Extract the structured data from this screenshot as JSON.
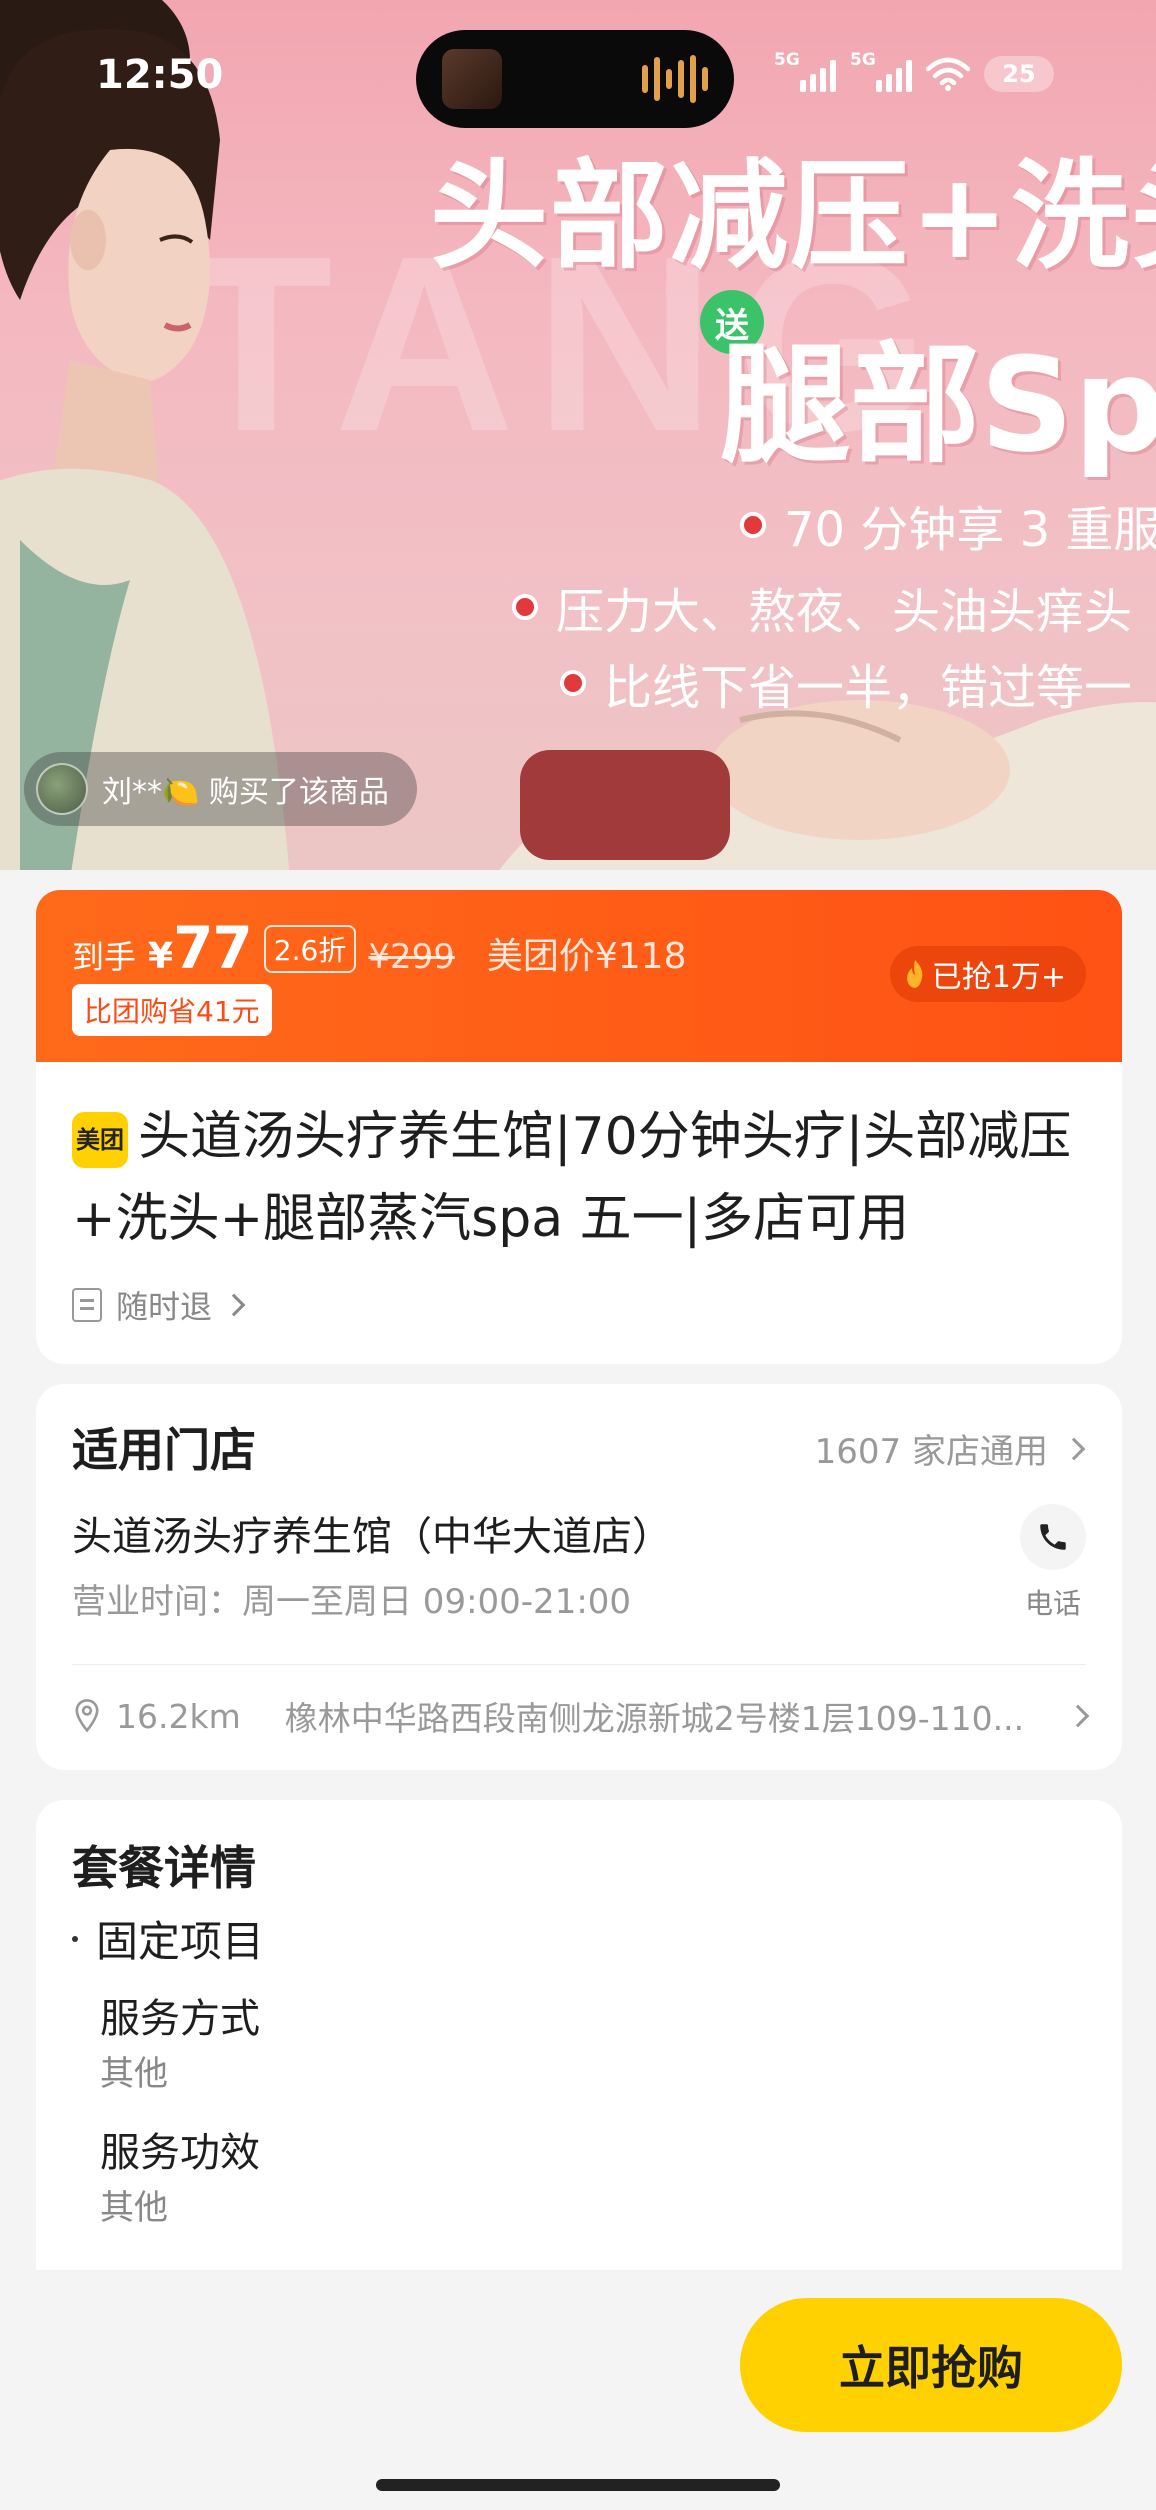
{
  "status_bar": {
    "time": "12:50",
    "signal1_label": "5G",
    "signal2_label": "5G",
    "battery": "25"
  },
  "hero": {
    "headline": "头部减压+洗头",
    "gift_badge": "送",
    "sub_headline": "腿部Sp",
    "bullets": [
      "70 分钟享 3 重服",
      "压力大、熬夜、头油头痒头",
      "比线下省一半，错过等一"
    ],
    "buyer_notice": "刘**🍋 购买了该商品"
  },
  "price": {
    "arrive_label": "到手",
    "currency": "¥",
    "final_price": "77",
    "discount": "2.6折",
    "original_price": "¥299",
    "meituan_price": "美团价¥118",
    "save_badge": "比团购省41元",
    "sold_badge": "已抢1万+",
    "accent_color": "#ff5214"
  },
  "product": {
    "brand_badge": "美团",
    "title": "头道汤头疗养生馆|70分钟头疗|头部减压+洗头+腿部蒸汽spa 五一|多店可用",
    "refund_policy": "随时退"
  },
  "store": {
    "header": "适用门店",
    "count_text": "1607 家店通用",
    "name": "头道汤头疗养生馆（中华大道店）",
    "hours": "营业时间：周一至周日 09:00-21:00",
    "phone_label": "电话",
    "distance": "16.2km",
    "address": "橡林中华路西段南侧龙源新城2号楼1层109-110..."
  },
  "package": {
    "header": "套餐详情",
    "section": "固定项目",
    "items": [
      {
        "label": "服务方式",
        "value": "其他"
      },
      {
        "label": "服务功效",
        "value": "其他"
      }
    ]
  },
  "actions": {
    "buy_now": "立即抢购",
    "button_color": "#ffd100"
  }
}
